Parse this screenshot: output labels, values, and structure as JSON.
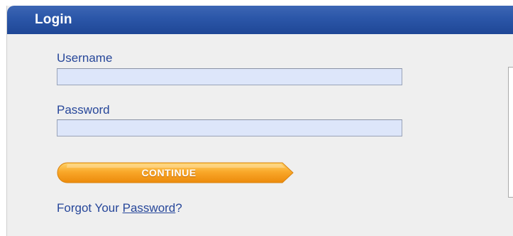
{
  "panel": {
    "title": "Login",
    "header_color": "#2b56a8",
    "background_color": "#efefef"
  },
  "form": {
    "username_label": "Username",
    "username_value": "",
    "password_label": "Password",
    "password_value": "",
    "input_background": "#dde6fa",
    "label_color": "#27479a"
  },
  "continue_button": {
    "label": "CONTINUE",
    "color": "#f39a10"
  },
  "forgot": {
    "prefix": "Forgot Your ",
    "link_text": "Password",
    "suffix": "?"
  }
}
